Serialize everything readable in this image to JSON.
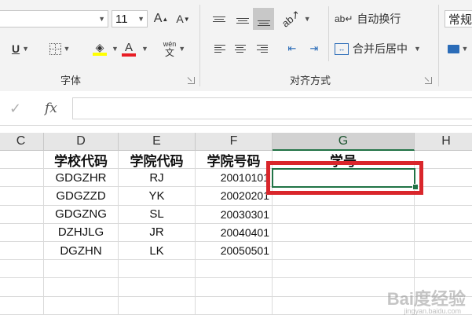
{
  "ribbon": {
    "font_name_value": "",
    "font_size_value": "11",
    "grow_font_icon": "A",
    "shrink_font_icon": "A",
    "underline_label": "U",
    "font_color_letter": "A",
    "phonetic_top": "wén",
    "phonetic_bottom": "文",
    "wrap_text_label": "自动换行",
    "merge_center_label": "合并后居中",
    "number_format_value": "常规",
    "font_group_label": "字体",
    "alignment_group_label": "对齐方式",
    "accent_colors": {
      "highlight": "#ffff00",
      "font_color": "#e81c24"
    }
  },
  "formula_bar": {
    "cancel_icon": "✓",
    "fx_label": "fx",
    "value": ""
  },
  "columns": [
    "C",
    "D",
    "E",
    "F",
    "G",
    "H"
  ],
  "selected_column": "G",
  "table": {
    "headers": [
      "学校代码",
      "学院代码",
      "学院号码",
      "学号"
    ],
    "rows": [
      [
        "GDGZHR",
        "RJ",
        "20010101",
        ""
      ],
      [
        "GDGZZD",
        "YK",
        "20020201",
        ""
      ],
      [
        "GDGZNG",
        "SL",
        "20030301",
        ""
      ],
      [
        "DZHJLG",
        "JR",
        "20040401",
        ""
      ],
      [
        "DGZHN",
        "LK",
        "20050501",
        ""
      ]
    ]
  },
  "watermark": {
    "text": "Bai度经验",
    "sub": "jingyan.baidu.com"
  },
  "colors": {
    "excel_green": "#217346",
    "highlight_red": "#d9262b"
  }
}
